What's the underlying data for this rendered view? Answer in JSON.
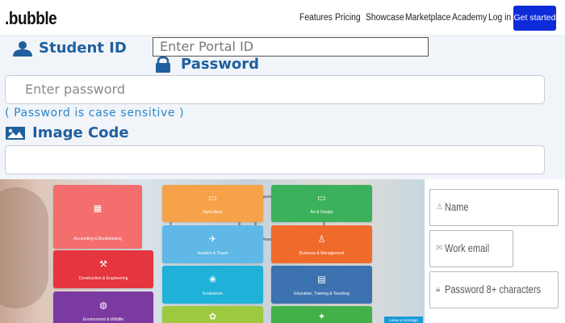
{
  "navbar": {
    "brand": ".bubble",
    "links": [
      "Features",
      "Pricing",
      "Showcase",
      "Marketplace",
      "Academy",
      "Log in"
    ],
    "cta": "Get started",
    "cta_color": "#0d2bd9"
  },
  "login_form": {
    "student_id_label": "Student ID",
    "portal_placeholder": "Enter Portal ID",
    "password_label": "Password",
    "password_placeholder": "Enter password",
    "case_hint": "( Password is case sensitive )",
    "image_code_label": "Image Code",
    "image_code_value": "",
    "label_color": "#1f5f9f",
    "hint_color": "#2a86c9",
    "icons": [
      "user-icon",
      "lock-icon",
      "image-icon"
    ]
  },
  "showcase": {
    "tiles": [
      {
        "label": "Accounting & Bookkeeping",
        "icon": "calculator-icon",
        "color": "#f46e6e"
      },
      {
        "label": "Agriculture",
        "icon": "folder-icon",
        "color": "#f6a24a"
      },
      {
        "label": "Art & Design",
        "icon": "monitor-icon",
        "color": "#3cb15b"
      },
      {
        "label": "Aviation & Travel",
        "icon": "airplane-icon",
        "color": "#5fb8e6"
      },
      {
        "label": "Business & Management",
        "icon": "people-icon",
        "color": "#f06b2b"
      },
      {
        "label": "Construction & Engineering",
        "icon": "tool-icon",
        "color": "#e5353e"
      },
      {
        "label": "Ecotourism",
        "icon": "globe-icon",
        "color": "#1fb1d8"
      },
      {
        "label": "Education, Training & Teaching",
        "icon": "board-icon",
        "color": "#3d72b0"
      },
      {
        "label": "Environment & Wildlife",
        "icon": "earth-icon",
        "color": "#7b3aa0"
      },
      {
        "label": "",
        "icon": "leaf-icon",
        "color": "#9cc93f"
      },
      {
        "label": "",
        "icon": "runner-icon",
        "color": "#43b14a"
      }
    ],
    "badge": "Leave a message"
  },
  "signup": {
    "fields": [
      {
        "placeholder": "Name",
        "icon": "person-icon"
      },
      {
        "placeholder": "Work email",
        "icon": "mail-icon"
      },
      {
        "placeholder": "Password 8+ characters",
        "icon": "padlock-icon"
      }
    ]
  }
}
